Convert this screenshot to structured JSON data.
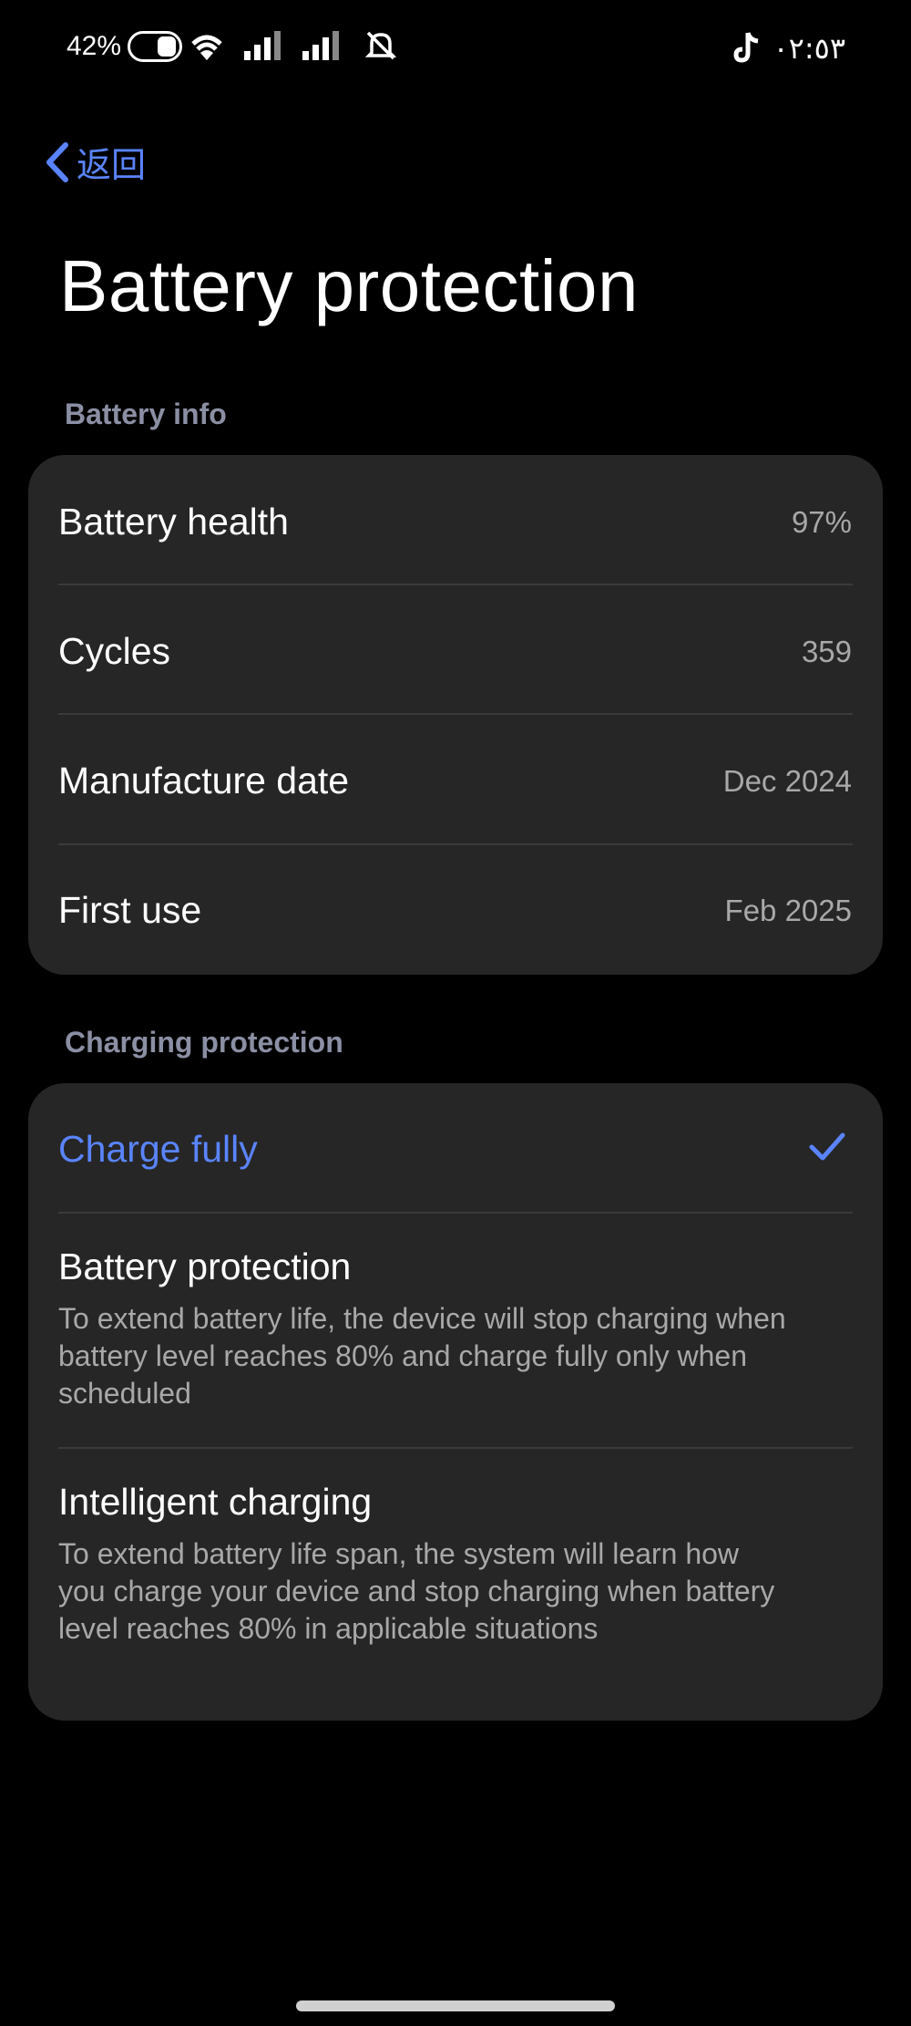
{
  "status_bar": {
    "battery_text": "42%",
    "time": "٠٢:٥٣",
    "icons": [
      "battery-saver-toggle-icon",
      "wifi-icon",
      "signal-icon",
      "signal-icon",
      "mute-icon",
      "tiktok-icon"
    ]
  },
  "nav": {
    "back_label": "返回"
  },
  "page": {
    "title": "Battery protection"
  },
  "battery_info": {
    "header": "Battery info",
    "rows": [
      {
        "label": "Battery health",
        "value": "97%"
      },
      {
        "label": "Cycles",
        "value": "359"
      },
      {
        "label": "Manufacture date",
        "value": "Dec 2024"
      },
      {
        "label": "First use",
        "value": "Feb 2025"
      }
    ]
  },
  "charging_protection": {
    "header": "Charging protection",
    "options": [
      {
        "title": "Charge fully",
        "selected": true
      },
      {
        "title": "Battery protection",
        "description": "To extend battery life, the device will stop charging when battery level reaches 80% and charge fully only when scheduled",
        "selected": false
      },
      {
        "title": "Intelligent charging",
        "description": "To extend battery life span, the system will learn how you charge your device and stop charging when battery level reaches 80% in applicable situations",
        "selected": false
      }
    ]
  },
  "colors": {
    "accent": "#5a84ff",
    "card": "#262626",
    "background": "#000000",
    "secondary_text": "#a8a8a8",
    "section_header": "#8b8fa3"
  }
}
